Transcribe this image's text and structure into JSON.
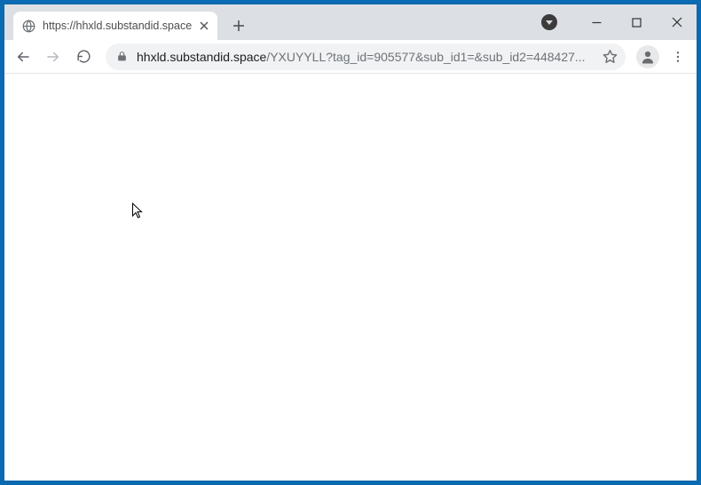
{
  "tab": {
    "title": "https://hhxld.substandid.space/Y",
    "favicon": "globe"
  },
  "window_controls": {
    "minimize": "minimize",
    "maximize": "maximize",
    "close": "close"
  },
  "toolbar": {
    "back": "back",
    "forward": "forward",
    "reload": "reload",
    "newtab_label": "+"
  },
  "address": {
    "host": "hhxld.substandid.space",
    "path": "/YXUYYLL?tag_id=905577&sub_id1=&sub_id2=448427..."
  }
}
